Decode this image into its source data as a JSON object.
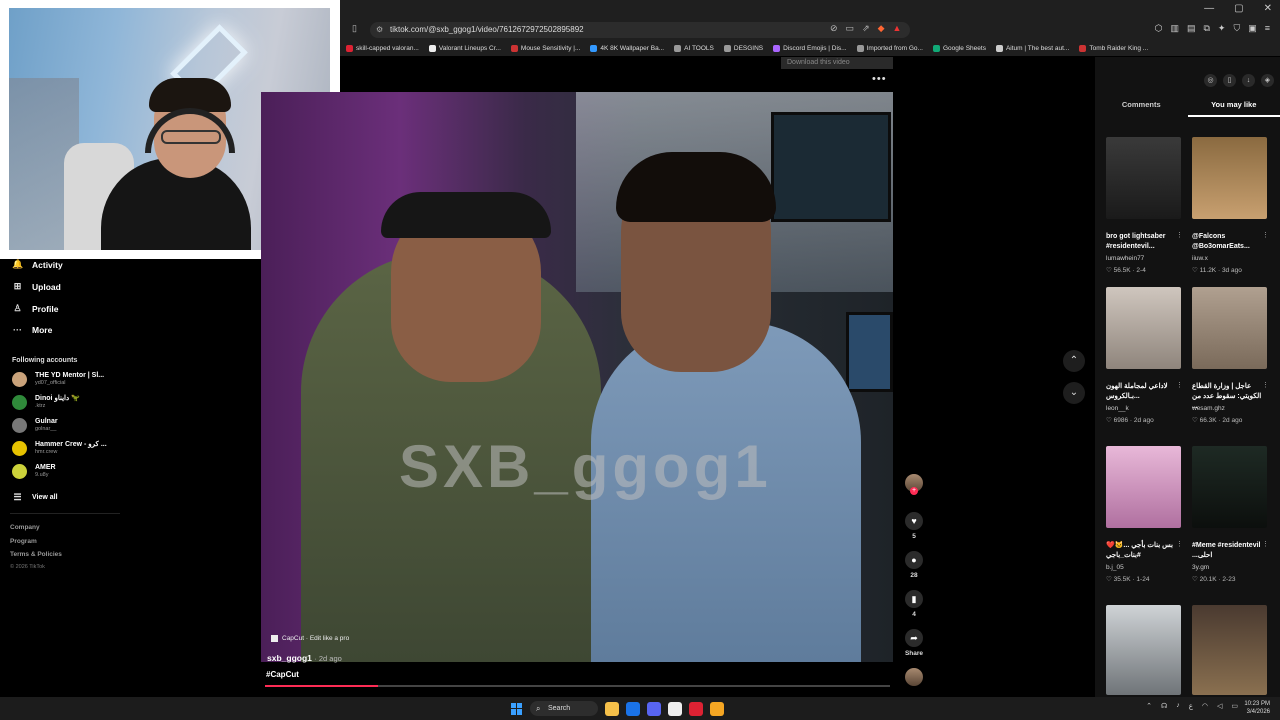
{
  "browser": {
    "url": "tiktok.com/@sxb_ggog1/video/7612672972502895892",
    "window_controls": [
      "—",
      "▢",
      "✕"
    ],
    "bookmarks": [
      {
        "label": "skill-capped valoran...",
        "color": "#d23"
      },
      {
        "label": "Valorant Lineups Cr...",
        "color": "#eee"
      },
      {
        "label": "Mouse Sensitivity |...",
        "color": "#c33"
      },
      {
        "label": "4K 8K Wallpaper Ba...",
        "color": "#39f"
      },
      {
        "label": "AI TOOLS",
        "color": "#999"
      },
      {
        "label": "DESGINS",
        "color": "#999"
      },
      {
        "label": "Discord Emojis | Dis...",
        "color": "#a6f"
      },
      {
        "label": "Imported from Go...",
        "color": "#999"
      },
      {
        "label": "Google Sheets",
        "color": "#1a7"
      },
      {
        "label": "Aitum | The best aut...",
        "color": "#ccc"
      },
      {
        "label": "Tomb Raider King ...",
        "color": "#c33"
      }
    ]
  },
  "sidebar": {
    "nav": [
      {
        "label": "Activity",
        "icon": "bell-icon",
        "glyph": "🔔"
      },
      {
        "label": "Upload",
        "icon": "plus-square-icon",
        "glyph": "⊞"
      },
      {
        "label": "Profile",
        "icon": "person-icon",
        "glyph": "♙"
      },
      {
        "label": "More",
        "icon": "dots-icon",
        "glyph": "···"
      }
    ],
    "following_title": "Following accounts",
    "accounts": [
      {
        "name": "THE YD Mentor | Sl...",
        "handle": "yd07_official",
        "color": "#c9a27a"
      },
      {
        "name": "Dinoi دايناو 🦖",
        "handle": ".ktrz",
        "color": "#2f8a3a"
      },
      {
        "name": "Gulnar",
        "handle": "golnar__",
        "color": "#777"
      },
      {
        "name": "Hammer Crew - كرو ...",
        "handle": "hmr.crew",
        "color": "#e6c200"
      },
      {
        "name": "AMER",
        "handle": "9.u8y",
        "color": "#ccd23a"
      }
    ],
    "view_all": "View all",
    "footer": [
      "Company",
      "Program",
      "Terms & Policies"
    ],
    "copyright": "© 2026 TikTok"
  },
  "video": {
    "download_label": "Download this video",
    "watermark": "SXB_ggog1",
    "capcut_label": "CapCut · Edit like a pro",
    "author": "sxb_ggog1",
    "posted": "2d ago",
    "hashtag": "#CapCut",
    "progress_fraction": 0.18,
    "likes": "5",
    "comments": "28",
    "saves": "4",
    "share_label": "Share",
    "colors": {
      "accent": "#fe2c55"
    }
  },
  "right_panel": {
    "tabs": [
      "Comments",
      "You may like"
    ],
    "active_tab": 1,
    "cards": [
      {
        "title": "bro got lightsaber #residentevil...",
        "user": "lumawhein77",
        "views": "56.5K",
        "date": "2-4",
        "bg": "linear-gradient(#3a3a3a,#1a1a1a)"
      },
      {
        "title": "@Falcons @Bo3omarEats...",
        "user": "iiuw.x",
        "views": "11.2K",
        "date": "3d ago",
        "bg": "linear-gradient(#8a6a40,#c8a070)"
      },
      {
        "title": "لاداعي لمجاملة الهون ...بـالكروس",
        "user": "leon__k",
        "views": "6986",
        "date": "2d ago",
        "bg": "linear-gradient(#cfc6be,#8f857c)"
      },
      {
        "title": "عاجل | وزارة القطاع الكويتي: سقوط عدد من ...",
        "user": "wesam.ghz",
        "views": "66.3K",
        "date": "2d ago",
        "bg": "linear-gradient(#b0a090,#7a6a5a)"
      },
      {
        "title": "بس بنات بأجي ...🐱❤️ #بنات_باجي",
        "user": "b.j_05",
        "views": "35.5K",
        "date": "1-24",
        "bg": "linear-gradient(#e8b8d8,#b070a0)"
      },
      {
        "title": "#Meme #residentevil ...احلى",
        "user": "3y.gm",
        "views": "20.1K",
        "date": "2-23",
        "bg": "linear-gradient(#1e2a24,#0c0f0d)"
      },
      {
        "title": "",
        "user": "",
        "views": "",
        "date": "",
        "bg": "linear-gradient(#cfd3d6,#6f7478)"
      },
      {
        "title": "",
        "user": "",
        "views": "",
        "date": "",
        "bg": "linear-gradient(#4a3a30,#8a7050)"
      }
    ]
  },
  "taskbar": {
    "search_label": "Search",
    "time": "10:23 PM",
    "date": "3/4/2026",
    "apps": [
      "#f5c04a",
      "#1a73e8",
      "#5865f2",
      "#eee",
      "#d23",
      "#f5a623"
    ]
  }
}
